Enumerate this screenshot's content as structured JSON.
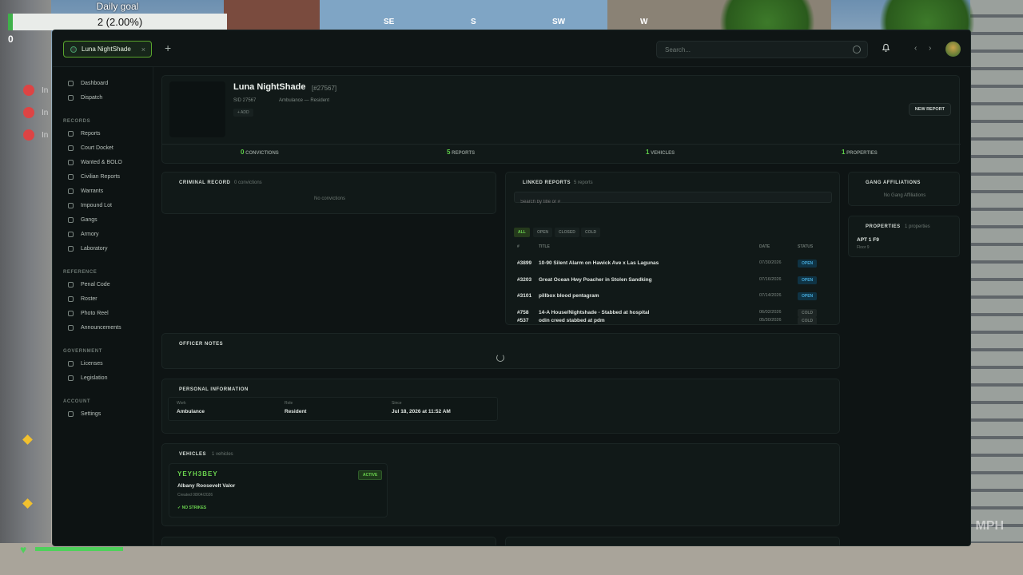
{
  "hud": {
    "daily_goal_title": "Daily goal",
    "daily_goal_value": "2 (2.00%)",
    "min": "0",
    "max": "100",
    "compass": [
      "SE",
      "S",
      "SW",
      "W"
    ],
    "ins_label": "In",
    "bottom_speed_unit": "MPH"
  },
  "tab": {
    "label": "Luna NightShade",
    "close": "×"
  },
  "add_tab": "+",
  "search": {
    "placeholder": "Search..."
  },
  "sidebar": {
    "top": [
      {
        "label": "Dashboard"
      },
      {
        "label": "Dispatch"
      }
    ],
    "records_head": "RECORDS",
    "records": [
      {
        "label": "Reports"
      },
      {
        "label": "Court Docket"
      },
      {
        "label": "Wanted & BOLO"
      },
      {
        "label": "Civilian Reports"
      },
      {
        "label": "Warrants"
      },
      {
        "label": "Impound Lot"
      },
      {
        "label": "Gangs"
      },
      {
        "label": "Armory"
      },
      {
        "label": "Laboratory"
      }
    ],
    "reference_head": "REFERENCE",
    "reference": [
      {
        "label": "Penal Code"
      },
      {
        "label": "Roster"
      },
      {
        "label": "Photo Reel"
      },
      {
        "label": "Announcements"
      }
    ],
    "government_head": "GOVERNMENT",
    "government": [
      {
        "label": "Licenses"
      },
      {
        "label": "Legislation"
      }
    ],
    "account_head": "ACCOUNT",
    "account": [
      {
        "label": "Settings"
      }
    ]
  },
  "profile": {
    "name": "Luna NightShade",
    "id": "[#27567]",
    "sid": "SID 27567",
    "job": "Ambulance — Resident",
    "add": "+ ADD",
    "new_report": "NEW REPORT"
  },
  "stats": [
    {
      "value": "0",
      "label": "CONVICTIONS"
    },
    {
      "value": "5",
      "label": "REPORTS"
    },
    {
      "value": "1",
      "label": "VEHICLES"
    },
    {
      "value": "1",
      "label": "PROPERTIES"
    }
  ],
  "criminal": {
    "title": "CRIMINAL RECORD",
    "count": "0 convictions",
    "empty": "No convictions"
  },
  "linked": {
    "title": "LINKED REPORTS",
    "count": "5 reports",
    "search_placeholder": "Search by title or #",
    "filters": [
      "ALL",
      "OPEN",
      "CLOSED",
      "COLD"
    ],
    "col_num": "#",
    "col_title": "TITLE",
    "col_date": "DATE",
    "col_status": "STATUS",
    "rows": [
      {
        "num": "#3899",
        "title": "10-90 Silent Alarm on Hawick Ave x Las Lagunas",
        "date": "07/30/2026",
        "status": "OPEN"
      },
      {
        "num": "#3203",
        "title": "Great Ocean Hwy Poacher in Stolen Sandking",
        "date": "07/16/2026",
        "status": "OPEN"
      },
      {
        "num": "#3101",
        "title": "pillbox blood pentagram",
        "date": "07/14/2026",
        "status": "OPEN"
      },
      {
        "num": "#758",
        "title": "14-A House/Nightshade - Stabbed at hospital",
        "date": "06/02/2026",
        "status": "COLD"
      },
      {
        "num": "#537",
        "title": "odin creed stabbed at pdm",
        "date": "05/30/2026",
        "status": "COLD"
      }
    ]
  },
  "gang": {
    "title": "GANG AFFILIATIONS",
    "empty": "No Gang Affiliations"
  },
  "properties": {
    "title": "PROPERTIES",
    "count": "1 properties",
    "item": "APT 1 F9",
    "item_sub": "Floor 9"
  },
  "notes": {
    "title": "OFFICER NOTES"
  },
  "personal": {
    "title": "PERSONAL INFORMATION",
    "work_label": "Work",
    "work": "Ambulance",
    "role_label": "Role",
    "role": "Resident",
    "since_label": "Since",
    "since": "Jul 18, 2026 at 11:52 AM"
  },
  "vehicles": {
    "title": "VEHICLES",
    "count": "1 vehicles",
    "plate": "YEYH3BEY",
    "status": "ACTIVE",
    "model": "Albany Roosevelt Valor",
    "created": "Created 08/04/2026",
    "strikes": "✓ NO STRIKES"
  }
}
